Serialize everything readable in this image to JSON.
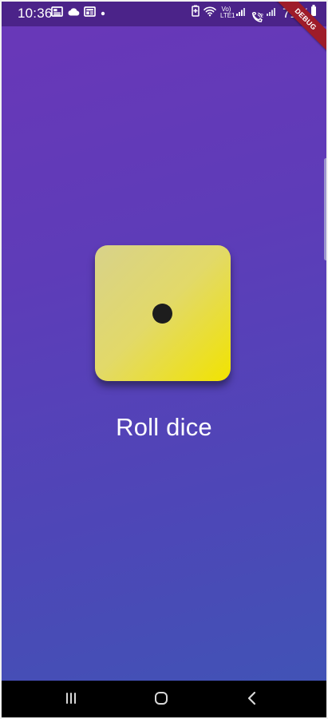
{
  "status_bar": {
    "time": "10:36",
    "network": "Vo)",
    "network_sub": "LTE1",
    "sim_label": "2",
    "battery_percent": "71%",
    "left_icons": [
      "gallery-icon",
      "cloud-icon",
      "mail-icon",
      "notification-dot-icon"
    ],
    "right_icons": [
      "battery-saver-icon",
      "wifi-icon",
      "cellular-icon",
      "wifi-calling-icon",
      "cellular-icon",
      "battery-icon"
    ]
  },
  "debug_banner": {
    "label": "DEBUG"
  },
  "dice": {
    "face_value": 1,
    "colors": {
      "face_start": "#d8d28a",
      "face_end": "#f1e300",
      "pip": "#1d1d1d"
    }
  },
  "action": {
    "label": "Roll dice"
  },
  "navigation": {
    "items": [
      {
        "name": "recent-apps-icon"
      },
      {
        "name": "home-icon"
      },
      {
        "name": "back-icon"
      }
    ]
  },
  "theme": {
    "background_top": "#6a37b8",
    "background_bottom": "#3f55b5",
    "text": "#ffffff"
  }
}
